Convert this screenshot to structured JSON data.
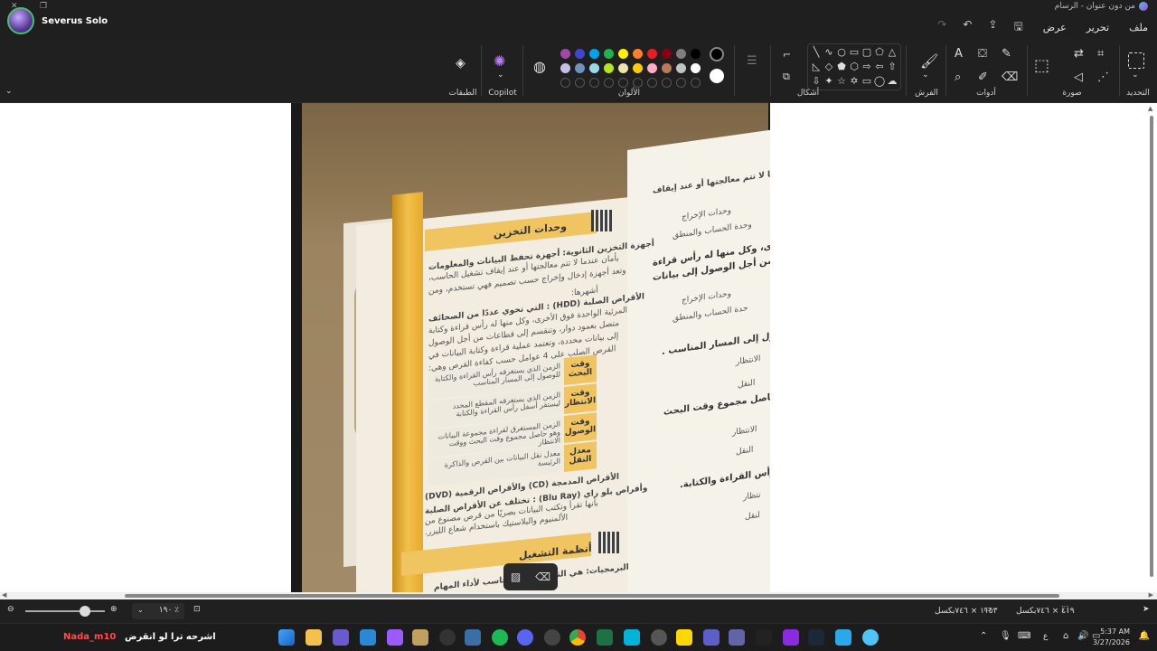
{
  "window": {
    "title": "من دون عنوان - الرسام",
    "user_name": "Severus Solo"
  },
  "menu": {
    "file": "ملف",
    "edit": "تحرير",
    "view": "عرض"
  },
  "ribbon": {
    "selection_label": "التحديد",
    "image_label": "صورة",
    "tools_label": "أدوات",
    "brushes_label": "الفرش",
    "shapes_label": "أشكال",
    "colors_label": "الألوان",
    "copilot_label": "Copilot",
    "layers_label": "الطبقات",
    "palette_row1": [
      "#000000",
      "#7f7f7f",
      "#880015",
      "#ed1c24",
      "#ff7f27",
      "#fff200",
      "#22b14c",
      "#00a2e8",
      "#3f48cc",
      "#a349a4"
    ],
    "palette_row2": [
      "#ffffff",
      "#c3c3c3",
      "#b97a57",
      "#ffaec9",
      "#ffc90e",
      "#efe4b0",
      "#b5e61d",
      "#99d9ea",
      "#7092be",
      "#c8bfe7"
    ],
    "primary_color": "#000000",
    "secondary_color": "#ffffff"
  },
  "photo_content": {
    "section1_title": "وحدات التخزين",
    "line1": "أجهزة التخزين الثانوية: أجهزة تحفظ البيانات والمعلومات",
    "line2": "بأمان عندما لا تتم معالجتها أو عند إيقاف تشغيل الحاسب،",
    "line3": "وتعد أجهزة إدخال وإخراج حسب تصميم فهي تستخدم، ومن",
    "line4": "أشهرها:",
    "hdd_line1": "الأقراص الصلبة (HDD) : التي تحوي عددًا من الصحائف",
    "hdd_line2": "المرئية الواحدة فوق الأخرى، وكل منها له رأس قراءة وكتابة",
    "hdd_line3": "متصل بعمود دوار، وتنقسم إلى قطاعات من أجل الوصول",
    "hdd_line4": "إلى بيانات محددة، وتعتمد عملية قراءة وكتابة البيانات في",
    "hdd_line5": "القرص الصلب على 4 عوامل حسب كفاءة القرص وهي:",
    "table": [
      {
        "key": "وقت البحث",
        "val": "الزمن الذي يستغرقه رأس القراءة والكتابة للوصول إلى المسار المناسب"
      },
      {
        "key": "وقت الانتظار",
        "val": "الزمن الذي يستغرقه المقطع المحدد ليستقر أسفل رأس القراءة والكتابة"
      },
      {
        "key": "وقت الوصول",
        "val": "الزمن المستغرق لقراءة مجموعة البيانات وهو حاصل مجموع وقت البحث ووقت الانتظار"
      },
      {
        "key": "معدل النقل",
        "val": "معدل نقل البيانات بين القرص والذاكرة الرئيسة"
      }
    ],
    "cd_line1": "الأقراص المدمجة (CD) والأقراص الرقمية (DVD)",
    "cd_line2": "وأقراص بلو راي (Blu Ray) : تختلف عن الأقراص الصلبة",
    "cd_line3": "بأنها تقرأ وتكتب البيانات بصريًا من قرص مصنوع من",
    "cd_line4": "الألمنيوم والبلاستيك باستخدام شعاع الليزر.",
    "section2_title": "أنظمة التشغيل",
    "os_line": "البرمجيات: هي التي يحتاجها الحاسب لأداء المهام",
    "right_page": [
      "عندما لا تتم معالجتها أو عند إيقاف",
      "وحدات الإخراج",
      "وحدة الحساب والمنطق",
      "ق الأخرى، وكل منها له رأس قراءة",
      "طاعات من أجل الوصول إلى بيانات",
      "وحدات الإخراج",
      "حدة الحساب والمنطق",
      "وصول إلى المسار المناسب .",
      "الانتظار",
      "النقل",
      "حاصل مجموع وقت البحث",
      "الانتظار",
      "النقل",
      "رأس القراءة والكتابة.",
      "نتظار",
      "لنقل"
    ]
  },
  "status": {
    "zoom": "١٩٠ ٪",
    "canvas_size": "٤١٩ × ٧٤٦بكسل",
    "selection_size": "١١٥٣ × ٧٤٦بكسل"
  },
  "taskbar": {
    "left_text": "اشرحه ترا لو انقرض",
    "user_tag": "Nada_m10",
    "time": "5:37 AM",
    "date": "3/27/2026",
    "lang": "ع"
  }
}
